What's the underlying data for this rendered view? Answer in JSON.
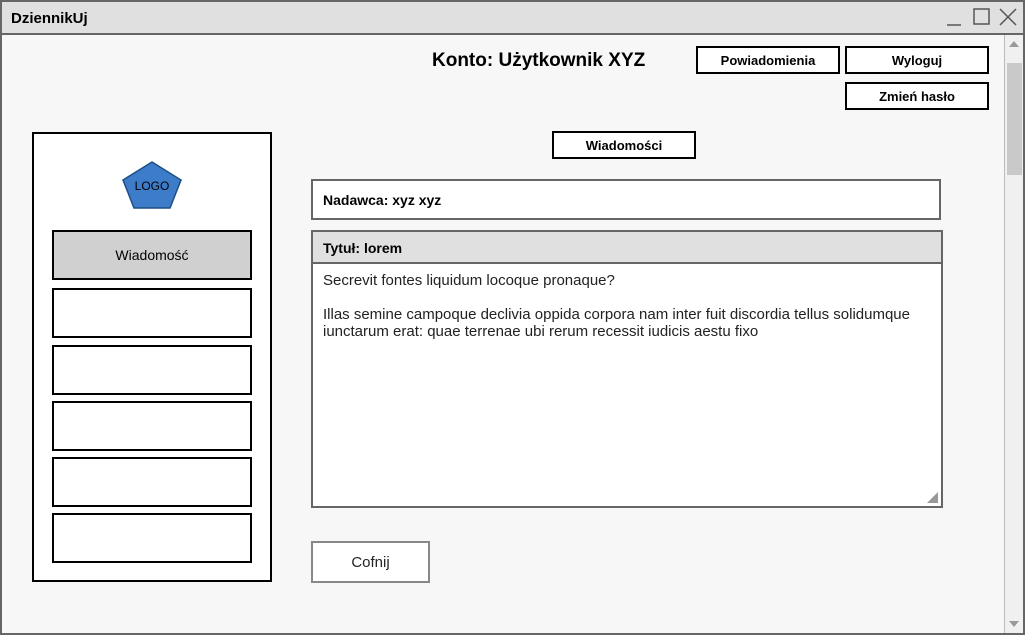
{
  "window": {
    "title": "DziennikUj"
  },
  "header": {
    "account_title": "Konto: Użytkownik XYZ",
    "notifications_label": "Powiadomienia",
    "logout_label": "Wyloguj",
    "change_password_label": "Zmień hasło"
  },
  "section_label": "Wiadomości",
  "sidebar": {
    "logo_text": "LOGO",
    "logo_color": "#3d7cc9",
    "items": [
      {
        "label": "Wiadomość",
        "active": true
      },
      {
        "label": ""
      },
      {
        "label": ""
      },
      {
        "label": ""
      },
      {
        "label": ""
      },
      {
        "label": ""
      }
    ]
  },
  "message": {
    "sender": "Nadawca: xyz xyz",
    "subject": "Tytuł: lorem",
    "body": [
      "Secrevit fontes liquidum locoque pronaque?",
      "Illas semine campoque declivia oppida corpora nam inter fuit discordia tellus solidumque iunctarum erat: quae terrenae ubi rerum recessit iudicis aestu fixo"
    ]
  },
  "back_label": "Cofnij",
  "icons": {
    "minimize": "minimize-icon",
    "maximize": "maximize-icon",
    "close": "close-icon",
    "logo": "pentagon-logo-icon"
  }
}
